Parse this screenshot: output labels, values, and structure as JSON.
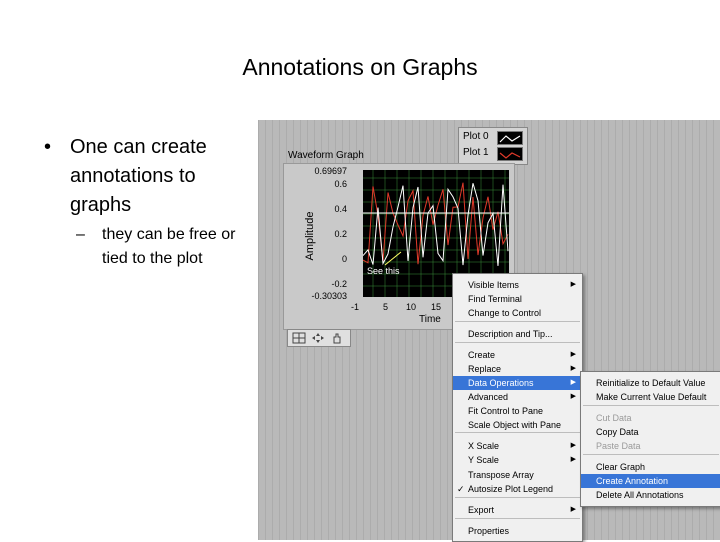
{
  "slide": {
    "title": "Annotations on Graphs",
    "bullet_symbol": "•",
    "bullet_text": "One can create annotations to graphs",
    "sub_symbol": "–",
    "sub_text": "they can be free or tied to the plot"
  },
  "legend": {
    "plot0": "Plot 0",
    "plot1": "Plot 1"
  },
  "graph": {
    "label": "Waveform Graph",
    "y_axis_label": "Amplitude",
    "x_axis_label": "Time",
    "y_ticks": [
      "0.69697",
      "0.6",
      "0.4",
      "0.2",
      "0",
      "-0.2",
      "-0.30303"
    ],
    "x_ticks": [
      "-1",
      "5",
      "10",
      "15"
    ],
    "annotation_text": "See this",
    "colors": {
      "plot0": "#ffffff",
      "plot1": "#e03a2a",
      "grid": "#3a8f3a",
      "cursor": "#ffff66"
    }
  },
  "toolbar": {
    "icons": [
      "zoom-icon",
      "pan-icon",
      "hand-icon"
    ]
  },
  "context_menu": {
    "items": [
      {
        "label": "Visible Items",
        "submenu": true
      },
      {
        "label": "Find Terminal"
      },
      {
        "label": "Change to Control"
      },
      {
        "label": "Description and Tip..."
      },
      {
        "label": "Create",
        "submenu": true
      },
      {
        "label": "Replace",
        "submenu": true
      },
      {
        "label": "Data Operations",
        "submenu": true,
        "highlighted": true
      },
      {
        "label": "Advanced",
        "submenu": true
      },
      {
        "label": "Fit Control to Pane"
      },
      {
        "label": "Scale Object with Pane"
      },
      {
        "label": "X Scale",
        "submenu": true
      },
      {
        "label": "Y Scale",
        "submenu": true
      },
      {
        "label": "Transpose Array"
      },
      {
        "label": "Autosize Plot Legend",
        "checked": true
      },
      {
        "label": "Export",
        "submenu": true
      },
      {
        "label": "Properties"
      }
    ],
    "arrow_glyph": "▶",
    "check_glyph": "✓"
  },
  "submenu": {
    "items": [
      {
        "label": "Reinitialize to Default Value"
      },
      {
        "label": "Make Current Value Default"
      },
      {
        "label": "Cut Data",
        "disabled": true
      },
      {
        "label": "Copy Data"
      },
      {
        "label": "Paste Data",
        "disabled": true
      },
      {
        "label": "Clear Graph"
      },
      {
        "label": "Create Annotation",
        "highlighted": true
      },
      {
        "label": "Delete All Annotations"
      }
    ]
  }
}
